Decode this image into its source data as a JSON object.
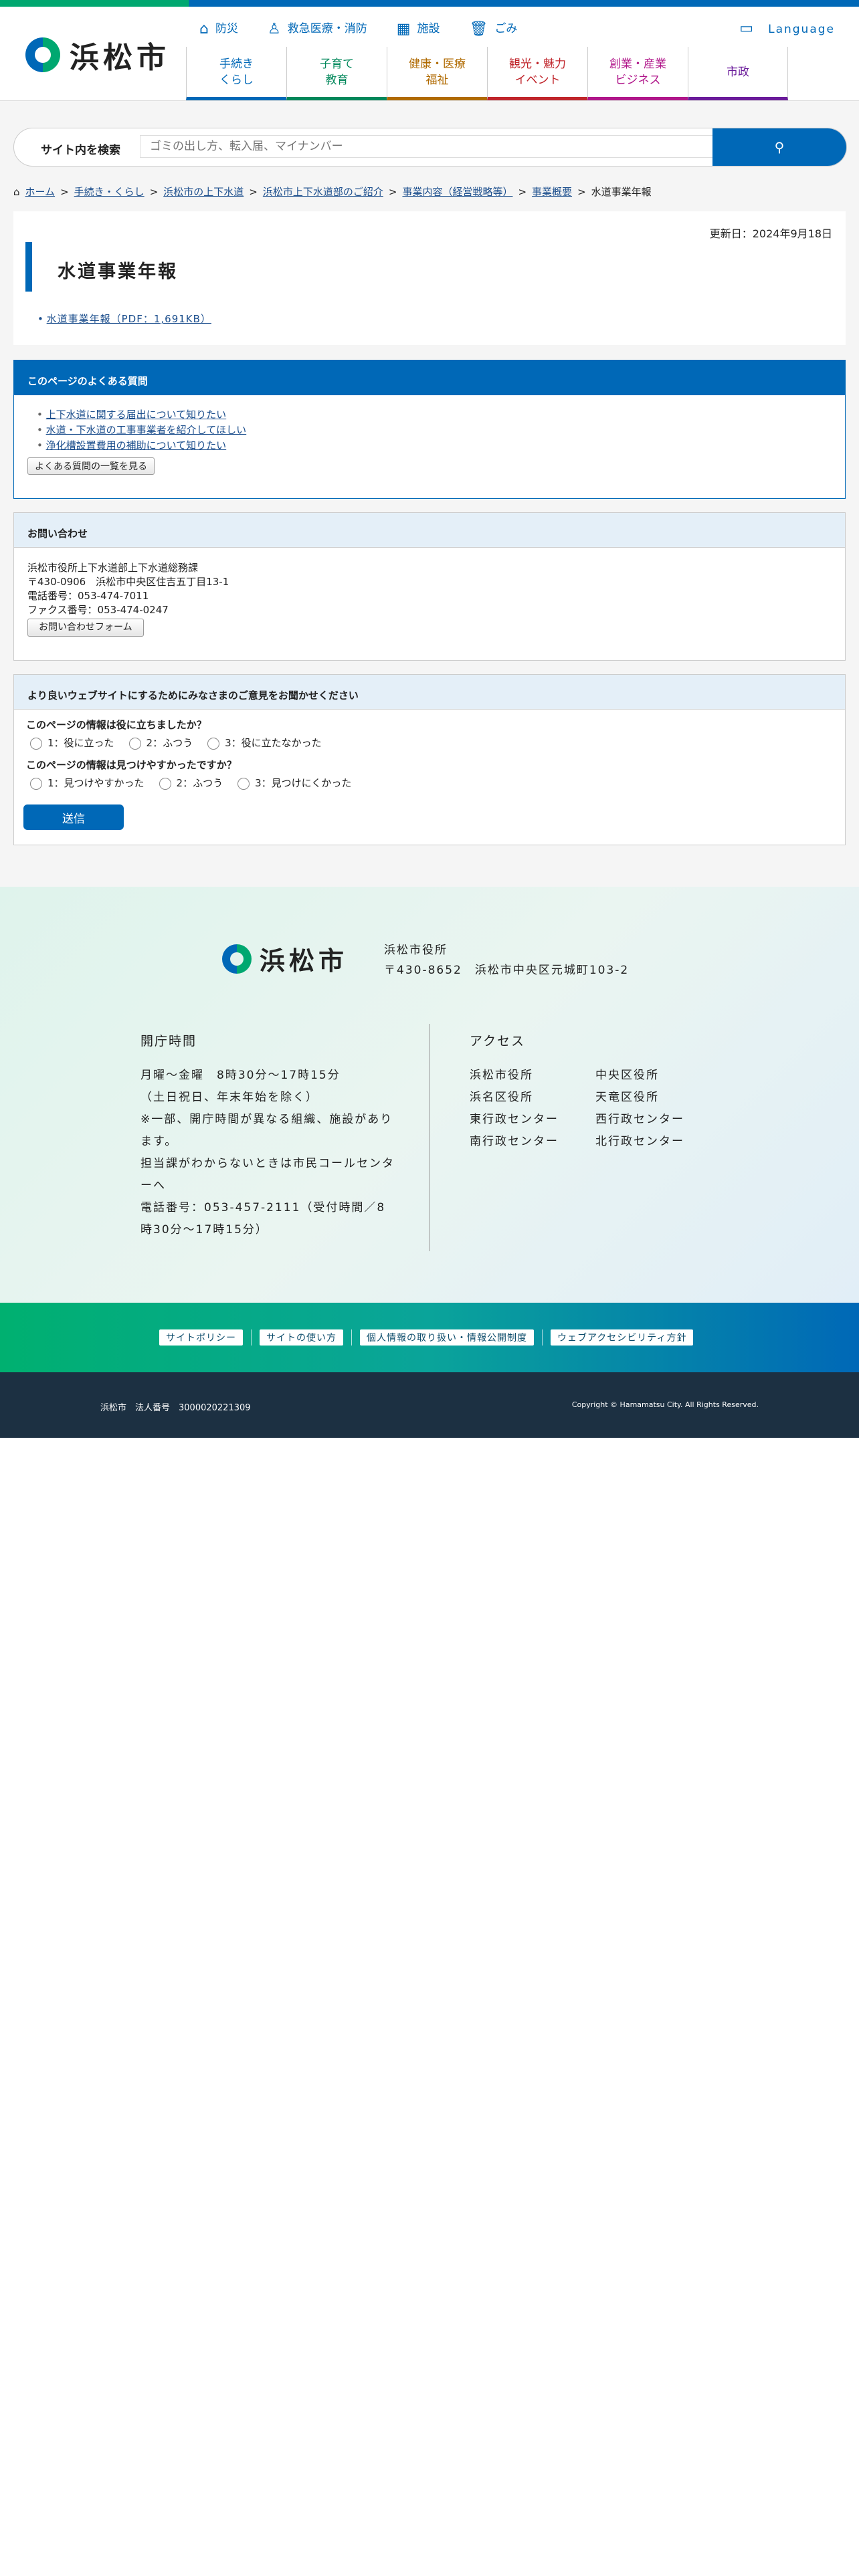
{
  "site": {
    "name": "浜松市"
  },
  "util_nav": [
    {
      "label": "防災",
      "icon": "house-icon"
    },
    {
      "label": "救急医療・消防",
      "icon": "doctor-icon"
    },
    {
      "label": "施設",
      "icon": "building-icon"
    },
    {
      "label": "ごみ",
      "icon": "trash-icon"
    }
  ],
  "language": "Language",
  "global_nav": [
    {
      "label": "手続き\nくらし",
      "color": "#0068b7"
    },
    {
      "label": "子育て\n教育",
      "color": "#00875a"
    },
    {
      "label": "健康・医療\n福祉",
      "color": "#b06a00"
    },
    {
      "label": "観光・魅力\nイベント",
      "color": "#c0252b"
    },
    {
      "label": "創業・産業\nビジネス",
      "color": "#b0168a"
    },
    {
      "label": "市政",
      "color": "#6a1b9a"
    }
  ],
  "search": {
    "label": "サイト内を検索",
    "placeholder": "ゴミの出し方、転入届、マイナンバー"
  },
  "breadcrumb": [
    "ホーム",
    "手続き・くらし",
    "浜松市の上下水道",
    "浜松市上下水道部のご紹介",
    "事業内容（経営戦略等）",
    "事業概要",
    "水道事業年報"
  ],
  "page": {
    "updated": "更新日：2024年9月18日",
    "title": "水道事業年報",
    "doc_link": "水道事業年報（PDF：1,691KB）"
  },
  "faq": {
    "heading": "このページのよくある質問",
    "items": [
      "上下水道に関する届出について知りたい",
      "水道・下水道の工事事業者を紹介してほしい",
      "浄化槽設置費用の補助について知りたい"
    ],
    "more": "よくある質問の一覧を見る"
  },
  "inquiry": {
    "heading": "お問い合わせ",
    "lines": [
      "浜松市役所上下水道部上下水道総務課",
      "〒430-0906　浜松市中央区住吉五丁目13-1",
      "電話番号：053-474-7011",
      "ファクス番号：053-474-0247"
    ],
    "form_button": "お問い合わせフォーム"
  },
  "feedback": {
    "heading": "より良いウェブサイトにするためにみなさまのご意見をお聞かせください",
    "q1": "このページの情報は役に立ちましたか？",
    "q1_opts": [
      "1：役に立った",
      "2：ふつう",
      "3：役に立たなかった"
    ],
    "q2": "このページの情報は見つけやすかったですか？",
    "q2_opts": [
      "1：見つけやすかった",
      "2：ふつう",
      "3：見つけにくかった"
    ],
    "submit": "送信"
  },
  "footer": {
    "office": "浜松市役所",
    "address": "〒430-8652　浜松市中央区元城町103-2",
    "hours_title": "開庁時間",
    "hours_lines": [
      "月曜～金曜　8時30分～17時15分",
      "（土日祝日、年末年始を除く）",
      "※一部、開庁時間が異なる組織、施設があります。",
      "担当課がわからないときは市民コールセンターへ",
      "電話番号：053-457-2111（受付時間／8時30分～17時15分）"
    ],
    "access_title": "アクセス",
    "access": [
      "浜松市役所",
      "中央区役所",
      "浜名区役所",
      "天竜区役所",
      "東行政センター",
      "西行政センター",
      "南行政センター",
      "北行政センター"
    ],
    "links": [
      "サイトポリシー",
      "サイトの使い方",
      "個人情報の取り扱い・情報公開制度",
      "ウェブアクセシビリティ方針"
    ],
    "corp_no": "浜松市　法人番号　3000020221309",
    "copyright": "Copyright © Hamamatsu City. All Rights Reserved."
  }
}
